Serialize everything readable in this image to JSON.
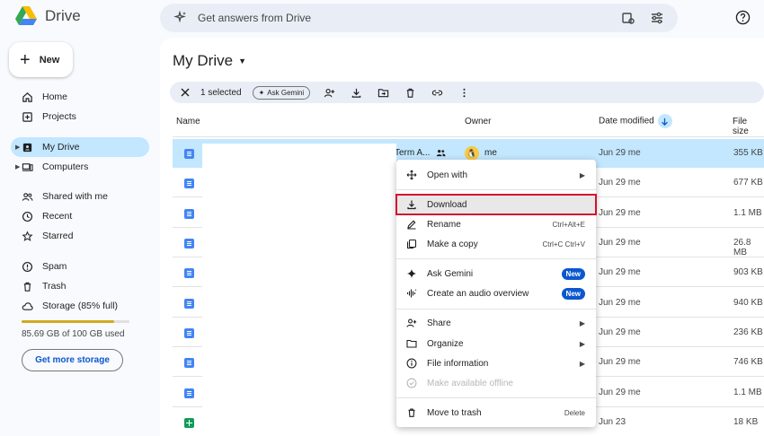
{
  "app": {
    "name": "Drive"
  },
  "search": {
    "placeholder": "Get answers from Drive"
  },
  "sidebar": {
    "new_label": "New",
    "items": [
      {
        "label": "Home",
        "icon": "home-icon"
      },
      {
        "label": "Projects",
        "icon": "projects-icon"
      },
      {
        "label": "My Drive",
        "icon": "my-drive-icon",
        "active": true
      },
      {
        "label": "Computers",
        "icon": "computers-icon"
      },
      {
        "label": "Shared with me",
        "icon": "shared-icon"
      },
      {
        "label": "Recent",
        "icon": "clock-icon"
      },
      {
        "label": "Starred",
        "icon": "star-icon"
      },
      {
        "label": "Spam",
        "icon": "spam-icon"
      },
      {
        "label": "Trash",
        "icon": "trash-icon"
      },
      {
        "label": "Storage (85% full)",
        "icon": "cloud-icon"
      }
    ],
    "storage_used_fraction": 0.8569,
    "storage_text": "85.69 GB of 100 GB used",
    "get_storage_label": "Get more storage"
  },
  "main": {
    "title": "My Drive",
    "toolbar": {
      "selected_text": "1 selected",
      "gemini_label": "Ask Gemini"
    },
    "columns": {
      "name": "Name",
      "owner": "Owner",
      "date": "Date modified",
      "size": "File size"
    },
    "rows": [
      {
        "type": "doc",
        "name_fragment": "Term A...",
        "owner": "me",
        "date": "Jun 29 me",
        "size": "355 KB",
        "selected": true
      },
      {
        "type": "doc",
        "date": "Jun 29 me",
        "size": "677 KB"
      },
      {
        "type": "doc",
        "date": "Jun 29 me",
        "size": "1.1 MB"
      },
      {
        "type": "doc",
        "date": "Jun 29 me",
        "size": "26.8 MB"
      },
      {
        "type": "doc",
        "date": "Jun 29 me",
        "size": "903 KB"
      },
      {
        "type": "doc",
        "date": "Jun 29 me",
        "size": "940 KB"
      },
      {
        "type": "doc",
        "date": "Jun 29 me",
        "size": "236 KB"
      },
      {
        "type": "doc",
        "date": "Jun 29 me",
        "size": "746 KB"
      },
      {
        "type": "doc",
        "date": "Jun 29 me",
        "size": "1.1 MB"
      },
      {
        "type": "sheet",
        "date": "Jun 23",
        "size": "18 KB"
      }
    ]
  },
  "context_menu": {
    "open_with": "Open with",
    "download": "Download",
    "rename": "Rename",
    "rename_shortcut": "Ctrl+Alt+E",
    "make_copy": "Make a copy",
    "make_copy_shortcut": "Ctrl+C Ctrl+V",
    "ask_gemini": "Ask Gemini",
    "audio_overview": "Create an audio overview",
    "new_badge": "New",
    "share": "Share",
    "organize": "Organize",
    "file_information": "File information",
    "available_offline": "Make available offline",
    "move_to_trash": "Move to trash",
    "delete_shortcut": "Delete"
  },
  "colors": {
    "selected_bg": "#c2e7ff",
    "accent": "#0b57d0",
    "highlight_border": "#d0142c",
    "storage_fill": "#d1a91f"
  }
}
